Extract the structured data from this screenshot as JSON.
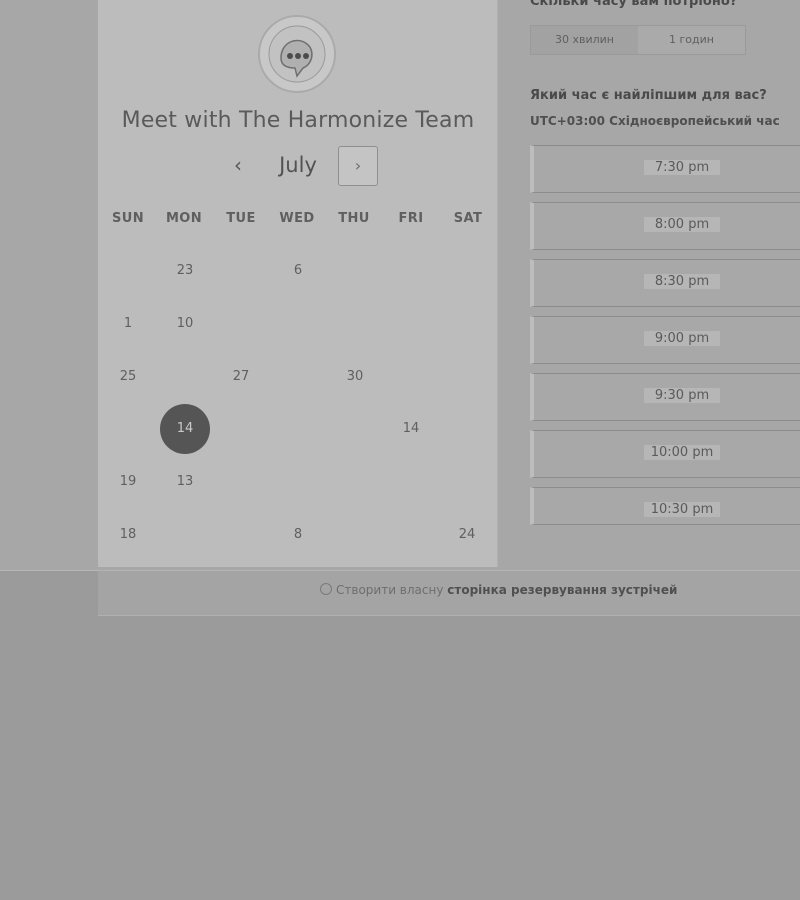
{
  "scheduler": {
    "title": "Meet with The Harmonize Team",
    "month": "July",
    "prev_glyph": "‹",
    "next_glyph": "›"
  },
  "calendar": {
    "weekdays": [
      "SUN",
      "MON",
      "TUE",
      "WED",
      "THU",
      "FRI",
      "SAT"
    ],
    "days": [
      {
        "label": "23",
        "row": 0,
        "col": 1
      },
      {
        "label": "6",
        "row": 0,
        "col": 3
      },
      {
        "label": "1",
        "row": 1,
        "col": 0
      },
      {
        "label": "10",
        "row": 1,
        "col": 1
      },
      {
        "label": "25",
        "row": 2,
        "col": 0
      },
      {
        "label": "27",
        "row": 2,
        "col": 2
      },
      {
        "label": "30",
        "row": 2,
        "col": 4
      },
      {
        "label": "14",
        "row": 3,
        "col": 1,
        "selected": true
      },
      {
        "label": "14",
        "row": 3,
        "col": 5
      },
      {
        "label": "19",
        "row": 4,
        "col": 0
      },
      {
        "label": "13",
        "row": 4,
        "col": 1
      },
      {
        "label": "18",
        "row": 5,
        "col": 0
      },
      {
        "label": "8",
        "row": 5,
        "col": 3
      },
      {
        "label": "24",
        "row": 5,
        "col": 6
      }
    ]
  },
  "booking": {
    "duration_question": "Скільки часу вам потрібно?",
    "durations": [
      {
        "label": "30 хвилин",
        "active": true
      },
      {
        "label": "1 годин",
        "active": false
      }
    ],
    "time_question": "Який час є найліпшим для вас?",
    "timezone": "UTC+03:00 Східноєвропейський час",
    "slots": [
      "7:30 pm",
      "8:00 pm",
      "8:30 pm",
      "9:00 pm",
      "9:30 pm",
      "10:00 pm",
      "10:30 pm"
    ]
  },
  "footer": {
    "link_prefix": "Створити власну",
    "link_bold": "сторінка резервування зустрічей"
  },
  "colors": {
    "background": "#9b9b9b",
    "card": "#bcbcbc",
    "selected_day": "#555555"
  }
}
